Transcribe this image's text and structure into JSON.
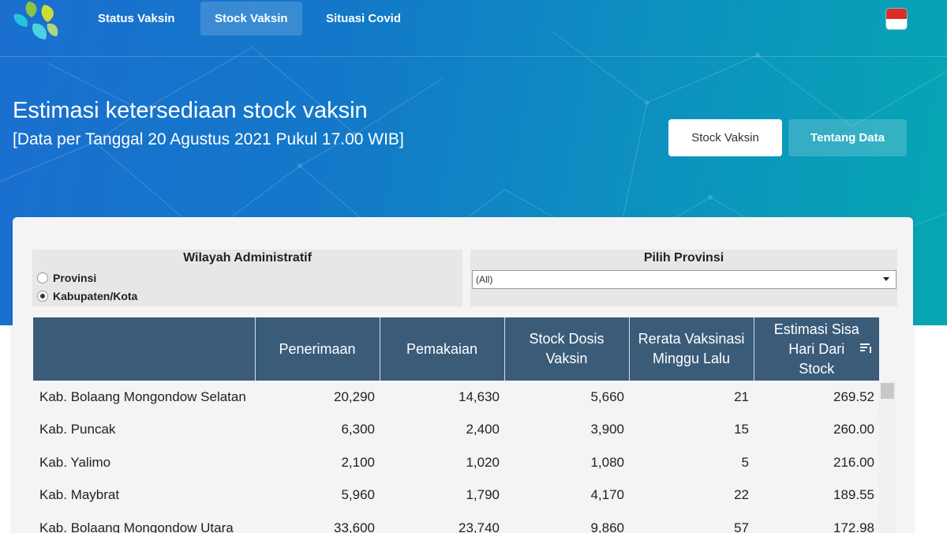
{
  "nav": {
    "items": [
      {
        "label": "Status Vaksin",
        "active": false
      },
      {
        "label": "Stock Vaksin",
        "active": true
      },
      {
        "label": "Situasi Covid",
        "active": false
      }
    ],
    "logo_icon": "kemenkes-leaf-logo-icon",
    "flag_icon": "indonesia-flag-icon"
  },
  "header": {
    "title": "Estimasi ketersediaan stock vaksin",
    "subtitle": "[Data per Tanggal 20 Agustus 2021 Pukul 17.00 WIB]"
  },
  "buttons": {
    "stock": "Stock Vaksin",
    "about": "Tentang Data"
  },
  "filters": {
    "admin": {
      "title": "Wilayah Administratif",
      "options": [
        {
          "label": "Provinsi",
          "checked": false
        },
        {
          "label": "Kabupaten/Kota",
          "checked": true
        }
      ]
    },
    "province": {
      "title": "Pilih Provinsi",
      "selected": "(All)"
    }
  },
  "table": {
    "columns": [
      "",
      "Penerimaan",
      "Pemakaian",
      "Stock Dosis Vaksin",
      "Rerata Vaksinasi Minggu Lalu",
      "Estimasi Sisa Hari Dari Stock"
    ],
    "rows": [
      [
        "Kab. Bolaang Mongondow Selatan",
        "20,290",
        "14,630",
        "5,660",
        "21",
        "269.52"
      ],
      [
        "Kab. Puncak",
        "6,300",
        "2,400",
        "3,900",
        "15",
        "260.00"
      ],
      [
        "Kab. Yalimo",
        "2,100",
        "1,020",
        "1,080",
        "5",
        "216.00"
      ],
      [
        "Kab. Maybrat",
        "5,960",
        "1,790",
        "4,170",
        "22",
        "189.55"
      ],
      [
        "Kab. Bolaang Mongondow Utara",
        "33,600",
        "23,740",
        "9,860",
        "57",
        "172.98"
      ]
    ],
    "sort_icon": "sort-descending-icon"
  },
  "colors": {
    "header_bg": "#3b5c79",
    "hero_start": "#1b6fcf",
    "hero_end": "#06a7b3"
  }
}
